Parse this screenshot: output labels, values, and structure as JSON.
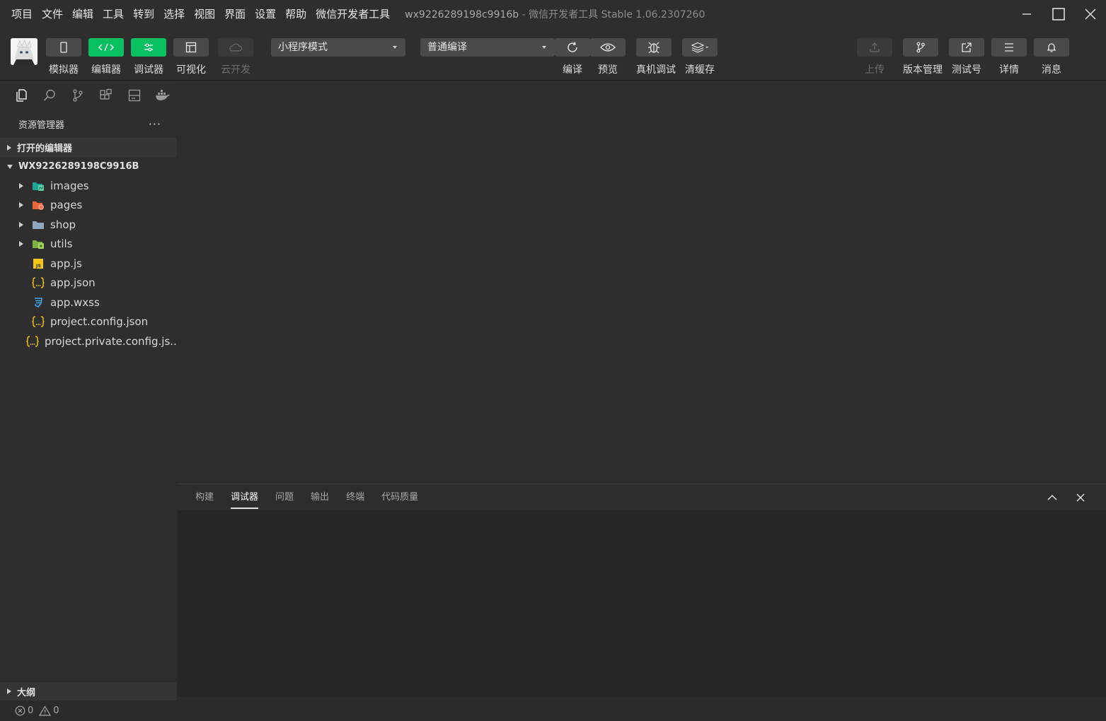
{
  "menu": [
    "项目",
    "文件",
    "编辑",
    "工具",
    "转到",
    "选择",
    "视图",
    "界面",
    "设置",
    "帮助",
    "微信开发者工具"
  ],
  "window": {
    "project": "wx9226289198c9916b",
    "suffix": " - 微信开发者工具 Stable 1.06.2307260"
  },
  "toolbar": {
    "simulator": "模拟器",
    "editor": "编辑器",
    "debugger": "调试器",
    "visual": "可视化",
    "cloud": "云开发",
    "mode_select": "小程序模式",
    "compile_select": "普通编译",
    "compile": "编译",
    "preview": "预览",
    "real_debug": "真机调试",
    "clear_cache": "清缓存",
    "upload": "上传",
    "version": "版本管理",
    "test_account": "测试号",
    "details": "详情",
    "messages": "消息"
  },
  "sidebar": {
    "title": "资源管理器",
    "more": "···",
    "open_editors": "打开的编辑器",
    "project": "WX9226289198C9916B",
    "files": [
      {
        "name": "images",
        "type": "folder",
        "icon": "images-folder-icon"
      },
      {
        "name": "pages",
        "type": "folder",
        "icon": "pages-folder-icon"
      },
      {
        "name": "shop",
        "type": "folder",
        "icon": "folder-icon"
      },
      {
        "name": "utils",
        "type": "folder",
        "icon": "utils-folder-icon"
      },
      {
        "name": "app.js",
        "type": "file",
        "icon": "js-file-icon"
      },
      {
        "name": "app.json",
        "type": "file",
        "icon": "json-file-icon"
      },
      {
        "name": "app.wxss",
        "type": "file",
        "icon": "css-file-icon"
      },
      {
        "name": "project.config.json",
        "type": "file",
        "icon": "json-file-icon"
      },
      {
        "name": "project.private.config.js...",
        "type": "file",
        "icon": "json-file-icon"
      }
    ],
    "outline": "大纲"
  },
  "panel": {
    "tabs": [
      "构建",
      "调试器",
      "问题",
      "输出",
      "终端",
      "代码质量"
    ],
    "active_tab": "调试器"
  },
  "status": {
    "errors": "0",
    "warnings": "0"
  },
  "colors": {
    "accent_green": "#07c160",
    "background": "#2b2b2b"
  }
}
